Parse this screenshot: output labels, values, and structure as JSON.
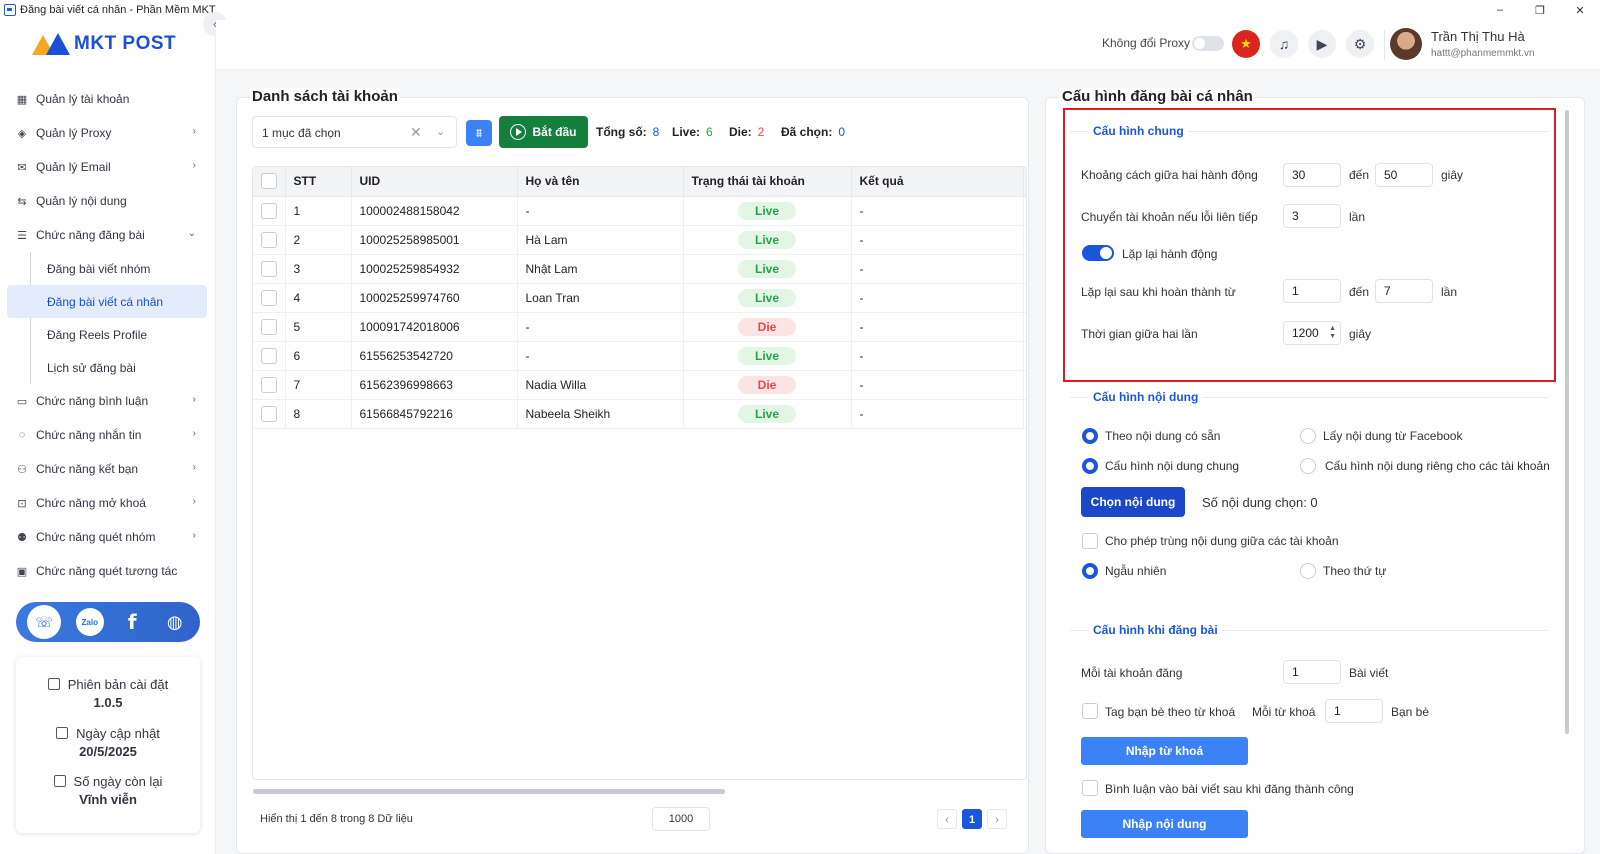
{
  "window": {
    "title": "Đăng bài viết cá nhân - Phần Mềm MKT",
    "controls": [
      "–",
      "❐",
      "✕"
    ]
  },
  "logo": {
    "text": "MKT POST"
  },
  "sidebar": {
    "items": [
      {
        "label": "Quản lý tài khoản",
        "icon": "grid-icon"
      },
      {
        "label": "Quản lý Proxy",
        "icon": "layers-icon",
        "chevron": "›"
      },
      {
        "label": "Quản lý Email",
        "icon": "mail-icon",
        "chevron": "›"
      },
      {
        "label": "Quản lý nội dung",
        "icon": "content-icon"
      },
      {
        "label": "Chức năng đăng bài",
        "icon": "post-icon",
        "chevron": "⌄"
      }
    ],
    "sub_items": [
      {
        "label": "Đăng bài viết nhóm"
      },
      {
        "label": "Đăng bài viết cá nhân",
        "active": true
      },
      {
        "label": "Đăng Reels Profile"
      },
      {
        "label": "Lịch sử đăng bài"
      }
    ],
    "items_after": [
      {
        "label": "Chức năng bình luận",
        "icon": "comment-icon",
        "chevron": "›"
      },
      {
        "label": "Chức năng nhắn tin",
        "icon": "chat-icon",
        "chevron": "›"
      },
      {
        "label": "Chức năng kết bạn",
        "icon": "add-friend-icon",
        "chevron": "›"
      },
      {
        "label": "Chức năng mở khoá",
        "icon": "lock-icon",
        "chevron": "›"
      },
      {
        "label": "Chức năng quét nhóm",
        "icon": "group-icon",
        "chevron": "›"
      },
      {
        "label": "Chức năng quét tương tác",
        "icon": "scan-icon"
      }
    ]
  },
  "social": {
    "zalo": "Zalo",
    "facebook": "f"
  },
  "info": {
    "version_label": "Phiên bản cài đặt",
    "version": "1.0.5",
    "updated_label": "Ngày cập nhật",
    "updated": "20/5/2025",
    "days_label": "Số ngày còn lại",
    "days": "Vĩnh viễn"
  },
  "header": {
    "proxy_label": "Không đổi Proxy",
    "user_name": "Trần Thị Thu Hà",
    "user_email": "hattt@phanmemmkt.vn"
  },
  "accounts": {
    "title": "Danh sách tài khoản",
    "select_value": "1 mục đã chọn",
    "start_label": "Bắt đầu",
    "stats": {
      "total_label": "Tổng số:",
      "total": "8",
      "live_label": "Live:",
      "live": "6",
      "die_label": "Die:",
      "die": "2",
      "selected_label": "Đã chọn:",
      "selected": "0"
    },
    "columns": [
      "STT",
      "UID",
      "Họ và tên",
      "Trạng thái tài khoản",
      "Kết quả"
    ],
    "rows": [
      {
        "stt": "1",
        "uid": "100002488158042",
        "name": "-",
        "status": "Live",
        "result": "-"
      },
      {
        "stt": "2",
        "uid": "100025258985001",
        "name": "Hà Lam",
        "status": "Live",
        "result": "-"
      },
      {
        "stt": "3",
        "uid": "100025259854932",
        "name": "Nhật Lam",
        "status": "Live",
        "result": "-"
      },
      {
        "stt": "4",
        "uid": "100025259974760",
        "name": "Loan Tran",
        "status": "Live",
        "result": "-"
      },
      {
        "stt": "5",
        "uid": "100091742018006",
        "name": "-",
        "status": "Die",
        "result": "-"
      },
      {
        "stt": "6",
        "uid": "61556253542720",
        "name": "-",
        "status": "Live",
        "result": "-"
      },
      {
        "stt": "7",
        "uid": "61562396998663",
        "name": "Nadia Willa",
        "status": "Die",
        "result": "-"
      },
      {
        "stt": "8",
        "uid": "61566845792216",
        "name": "Nabeela Sheikh",
        "status": "Live",
        "result": "-"
      }
    ],
    "footer_text": "Hiển thị 1 đến 8 trong 8 Dữ liệu",
    "page_size": "1000",
    "page_prev": "‹",
    "page_current": "1",
    "page_next": "›"
  },
  "config": {
    "title": "Cấu hình đăng bài cá nhân",
    "general": {
      "title": "Cấu hình chung",
      "delay_label": "Khoảng cách giữa hai hành động",
      "delay_from": "30",
      "to_label": "đến",
      "delay_to": "50",
      "seconds_label": "giây",
      "switch_label": "Chuyển tài khoản nếu lỗi liên tiếp",
      "switch_value": "3",
      "times_label": "lần",
      "repeat_label": "Lặp lại hành động",
      "repeat_after_label": "Lặp lại sau khi hoàn thành từ",
      "repeat_from": "1",
      "repeat_to": "7",
      "interval_label": "Thời gian giữa hai lần",
      "interval_value": "1200"
    },
    "content": {
      "title": "Cấu hình nội dung",
      "opt_available": "Theo nội dung có sẵn",
      "opt_facebook": "Lấy nội dung từ Facebook",
      "opt_common": "Cấu hình nội dung chung",
      "opt_separate": "Cấu hình nội dung riêng cho các tài khoản",
      "choose_btn": "Chọn nội dung",
      "chosen_count": "Số nội dung chọn: 0",
      "allow_duplicate": "Cho phép trùng nội dung giữa các tài khoản",
      "opt_random": "Ngẫu nhiên",
      "opt_order": "Theo thứ tự"
    },
    "posting": {
      "title": "Cấu hình khi đăng bài",
      "per_account_label": "Mỗi tài khoản đăng",
      "per_account_value": "1",
      "posts_unit": "Bài viết",
      "tag_label": "Tag bạn bè theo từ khoá",
      "per_keyword_label": "Mỗi từ khoá",
      "per_keyword_value": "1",
      "friends_unit": "Bạn bè",
      "keyword_btn": "Nhập từ khoá",
      "comment_label": "Bình luận vào bài viết sau khi đăng thành công",
      "content_btn": "Nhập nội dung"
    }
  }
}
